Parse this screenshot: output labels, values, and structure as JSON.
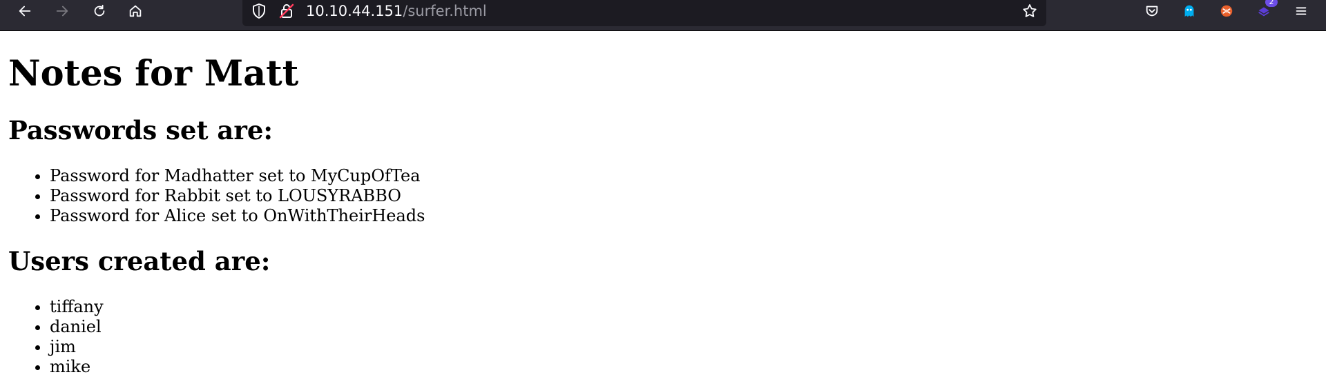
{
  "browser": {
    "url_host": "10.10.44.151",
    "url_path": "/surfer.html",
    "extension_badge": "2",
    "icons": [
      "back-icon",
      "forward-icon",
      "reload-icon",
      "home-icon",
      "tracking-shield-icon",
      "insecure-lock-icon",
      "bookmark-star-icon",
      "pocket-icon",
      "ghostery-icon",
      "burp-icon",
      "extension-icon",
      "menu-icon"
    ],
    "colors": {
      "toolbar": "#2b2a33",
      "urlbar": "#1c1b22",
      "text": "#fbfbfe"
    }
  },
  "page": {
    "title": "Notes for Matt",
    "passwords_heading": "Passwords set are:",
    "passwords": [
      "Password for Madhatter set to MyCupOfTea",
      "Password for Rabbit set to LOUSYRABBO",
      "Password for Alice set to OnWithTheirHeads"
    ],
    "users_heading": "Users created are:",
    "users": [
      "tiffany",
      "daniel",
      "jim",
      "mike"
    ]
  }
}
